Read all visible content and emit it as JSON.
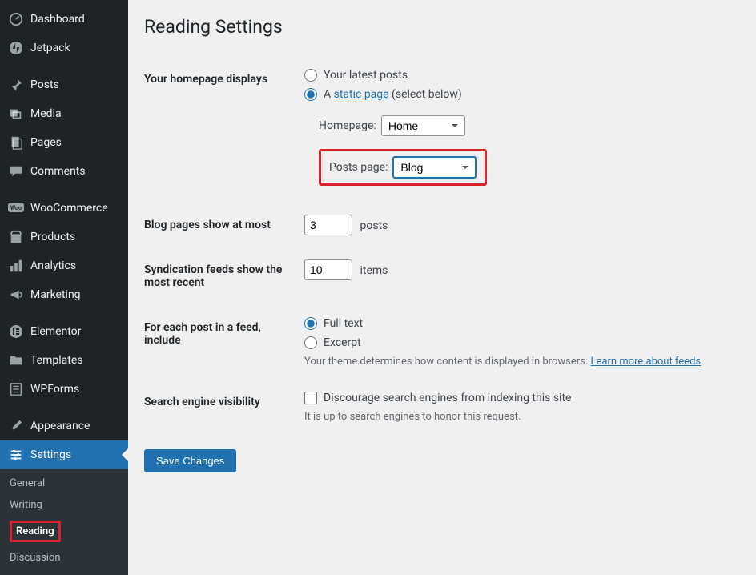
{
  "page_title": "Reading Settings",
  "sidebar": {
    "items": [
      {
        "label": "Dashboard",
        "icon": "dashboard"
      },
      {
        "label": "Jetpack",
        "icon": "jetpack"
      },
      {
        "label": "Posts",
        "icon": "posts"
      },
      {
        "label": "Media",
        "icon": "media"
      },
      {
        "label": "Pages",
        "icon": "pages"
      },
      {
        "label": "Comments",
        "icon": "comments"
      },
      {
        "label": "WooCommerce",
        "icon": "woo"
      },
      {
        "label": "Products",
        "icon": "products"
      },
      {
        "label": "Analytics",
        "icon": "analytics"
      },
      {
        "label": "Marketing",
        "icon": "marketing"
      },
      {
        "label": "Elementor",
        "icon": "elementor"
      },
      {
        "label": "Templates",
        "icon": "templates"
      },
      {
        "label": "WPForms",
        "icon": "wpforms"
      },
      {
        "label": "Appearance",
        "icon": "appearance"
      },
      {
        "label": "Settings",
        "icon": "settings"
      }
    ],
    "submenu": {
      "items": [
        {
          "label": "General"
        },
        {
          "label": "Writing"
        },
        {
          "label": "Reading",
          "active": true
        },
        {
          "label": "Discussion"
        }
      ]
    }
  },
  "homepage_section": {
    "label": "Your homepage displays",
    "opt_latest": "Your latest posts",
    "opt_static_prefix": "A ",
    "opt_static_link": "static page",
    "opt_static_suffix": " (select below)",
    "homepage_label": "Homepage:",
    "homepage_value": "Home",
    "posts_label": "Posts page:",
    "posts_value": "Blog"
  },
  "blog_pages": {
    "label": "Blog pages show at most",
    "value": "3",
    "unit": "posts"
  },
  "syndication": {
    "label": "Syndication feeds show the most recent",
    "value": "10",
    "unit": "items"
  },
  "feed_include": {
    "label": "For each post in a feed, include",
    "opt_full": "Full text",
    "opt_excerpt": "Excerpt",
    "desc_prefix": "Your theme determines how content is displayed in browsers. ",
    "desc_link": "Learn more about feeds",
    "desc_suffix": "."
  },
  "search_engine": {
    "label": "Search engine visibility",
    "checkbox_label": "Discourage search engines from indexing this site",
    "desc": "It is up to search engines to honor this request."
  },
  "save_button": "Save Changes"
}
